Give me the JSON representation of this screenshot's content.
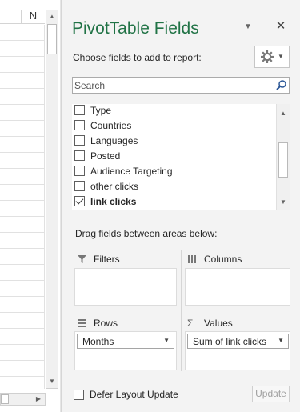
{
  "sheet": {
    "column_letter": "N"
  },
  "panel": {
    "title": "PivotTable Fields",
    "choose_label": "Choose fields to add to report:",
    "search": {
      "placeholder": "Search",
      "value": ""
    },
    "fields": [
      {
        "label": "Type",
        "checked": false,
        "bold": false
      },
      {
        "label": "Countries",
        "checked": false,
        "bold": false
      },
      {
        "label": "Languages",
        "checked": false,
        "bold": false
      },
      {
        "label": "Posted",
        "checked": false,
        "bold": false
      },
      {
        "label": "Audience Targeting",
        "checked": false,
        "bold": false
      },
      {
        "label": "other clicks",
        "checked": false,
        "bold": false
      },
      {
        "label": "link clicks",
        "checked": true,
        "bold": true
      }
    ],
    "drag_label": "Drag fields between areas below:",
    "areas": {
      "filters": {
        "label": "Filters",
        "icon": "filter-icon"
      },
      "columns": {
        "label": "Columns",
        "icon": "columns-icon"
      },
      "rows": {
        "label": "Rows",
        "icon": "rows-icon",
        "item": "Months"
      },
      "values": {
        "label": "Values",
        "icon": "sigma-icon",
        "item": "Sum of link clicks"
      }
    },
    "defer_label": "Defer Layout Update",
    "update_label": "Update",
    "accent_color": "#217346"
  }
}
